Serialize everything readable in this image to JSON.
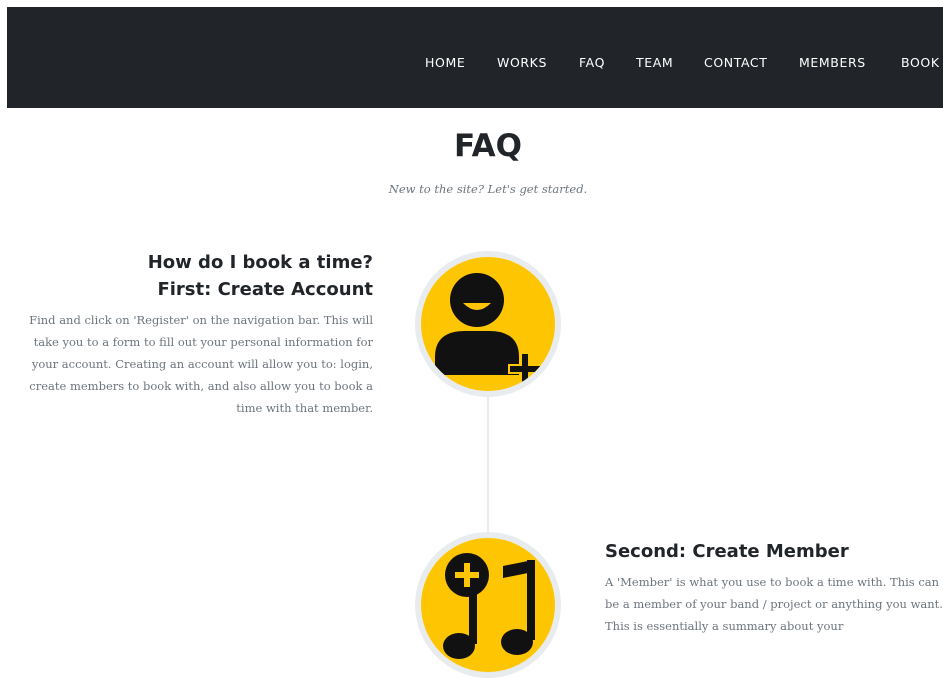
{
  "nav": {
    "items": [
      "HOME",
      "WORKS",
      "FAQ",
      "TEAM",
      "CONTACT",
      "MEMBERS",
      "BOOK"
    ]
  },
  "colors": {
    "navbar": "#212529",
    "accent": "#fec503",
    "ring": "#e9ecef",
    "heading": "#212529",
    "muted": "#6c757d"
  },
  "page": {
    "title": "FAQ",
    "subtitle": "New to the site? Let's get started."
  },
  "timeline": [
    {
      "icon": "add-user-icon",
      "heading": "How do I book a time?",
      "subheading": "First: Create Account",
      "body": "Find and click on 'Register' on the navigation bar. This will take you to a form to fill out your personal information for your account. Creating an account will allow you to: login, create members to book with, and also allow you to book a time with that member."
    },
    {
      "icon": "add-music-icon",
      "subheading": "Second: Create Member",
      "body": "A 'Member' is what you use to book a time with. This can be a member of your band / project or anything you want. This is essentially a summary about your"
    }
  ]
}
